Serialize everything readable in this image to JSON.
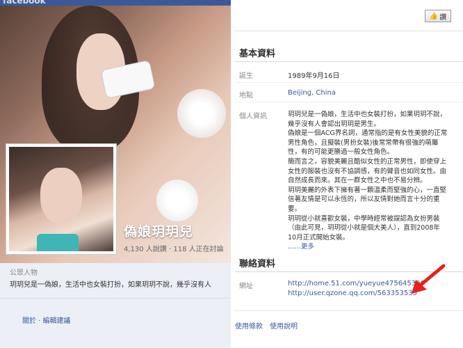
{
  "left": {
    "site_brand": "facebook",
    "page_name": "偽娘玥玥兒",
    "likes": "4,130 人說讚",
    "talking": "118 人正在討論",
    "separator": " · ",
    "category": "公眾人物",
    "description": "玥玥兒是一偽娘，生活中也女裝打扮，如果玥玥不說，幾乎沒有人",
    "about_link": "關於 · 編輯建議"
  },
  "right": {
    "like_button": "讚",
    "basic_info": {
      "title": "基本資料",
      "birthday_label": "誕生",
      "birthday": "1989年9月16日",
      "location_label": "地點",
      "location": "Beijing, China",
      "personal_label": "個人資訊",
      "bio_lines": [
        "玥玥兒是一偽娘，生活中也女裝打扮，如果玥玥不說，",
        "幾乎沒有人會認出玥玥是男生。",
        "偽娘是一個ACG界名詞，通常指的是有女性美貌的正常",
        "男性角色，且擬裝(男扮女裝)後常常帶有很強的萌屬",
        "性，有的可能更勝過一般女性角色。",
        "簡而言之，容貌美麗且酷似女性的正常男性，即使穿上",
        "女性的服裝也沒有不協調感，有的聲音也如同女性。由",
        "自然成長而來。其在一群女性之中也不易分辨。",
        "玥玥美麗的外表下擁有著一顆溫柔而堅強的心，一直堅",
        "信著友情是可以永恆的，所以友情對她而言十分的重",
        "要。",
        "玥玥從小就喜歡女裝，中學時經常被誤認為女扮男裝",
        "（由此可見，玥玥從小就是個大美人），直到2008年",
        "10月正式開始女裝。"
      ],
      "more": "……更多"
    },
    "contact_info": {
      "title": "聯絡資料",
      "website_label": "網址",
      "urls": [
        "http://home.51.com/yueyue475645390",
        "http://user.qzone.qq.com/563353535"
      ]
    },
    "footer": {
      "terms": "使用條款",
      "help": "使用說明"
    },
    "annotation_color": "#e8201c"
  }
}
